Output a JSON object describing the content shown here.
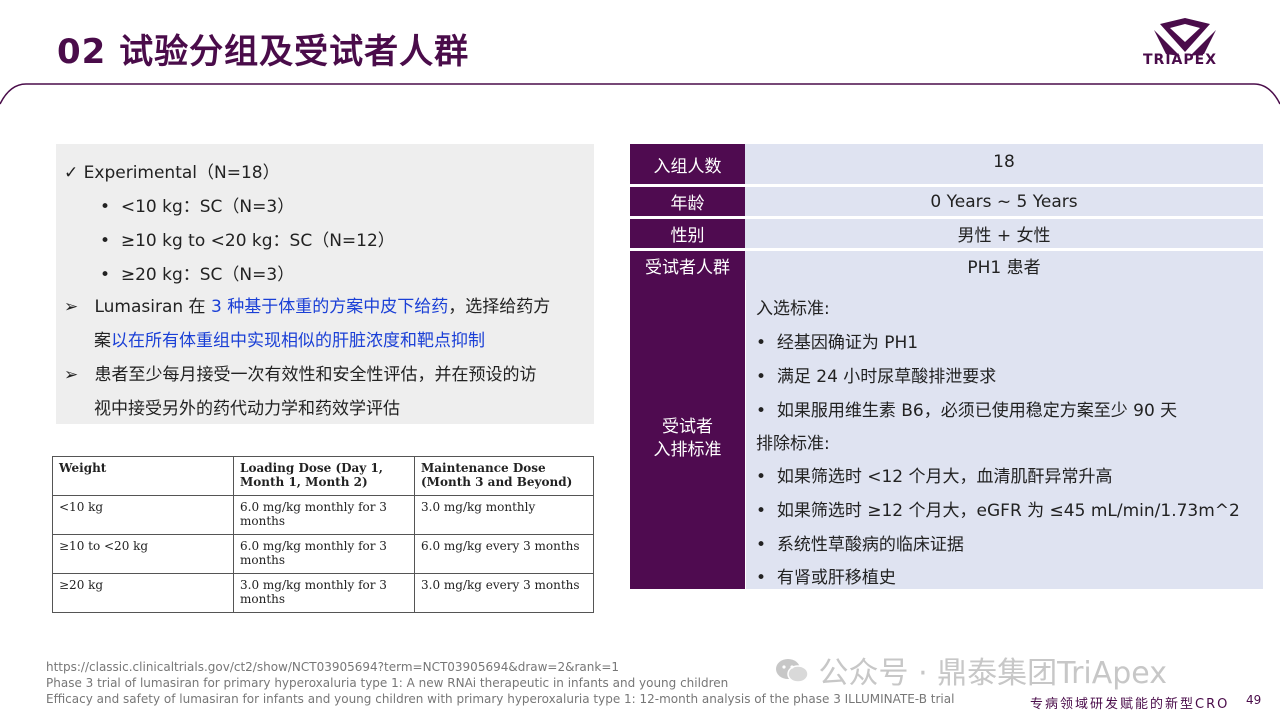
{
  "header": {
    "title": "02 试验分组及受试者人群",
    "logo_text": "TRIAPEX"
  },
  "experimental": {
    "heading": "✓ Experimental（N=18）",
    "bullets": [
      "<10 kg：SC（N=3）",
      "≥10 kg to <20 kg：SC（N=12）",
      "≥20 kg：SC（N=3）"
    ],
    "arrow1_a": "Lumasiran 在 ",
    "arrow1_b": "3 种基于体重的方案中皮下给药",
    "arrow1_c": "，选择给药方",
    "arrow1_d": "案",
    "arrow1_e": "以在所有体重组中实现相似的肝脏浓度和靶点抑制",
    "arrow2_line1": "患者至少每月接受一次有效性和安全性评估，并在预设的访",
    "arrow2_line2": "视中接受另外的药代动力学和药效学评估",
    "arrow_symbol": "➢",
    "bullet_symbol": "•"
  },
  "dose_table": {
    "headers": [
      "Weight",
      "Loading Dose (Day 1, Month 1, Month 2)",
      "Maintenance Dose (Month 3 and Beyond)"
    ],
    "rows": [
      [
        "<10 kg",
        "6.0 mg/kg monthly for 3 months",
        "3.0 mg/kg monthly"
      ],
      [
        "≥10 to <20 kg",
        "6.0 mg/kg monthly for 3 months",
        "6.0 mg/kg every 3 months"
      ],
      [
        "≥20 kg",
        "3.0 mg/kg monthly for 3 months",
        "3.0 mg/kg every 3 months"
      ]
    ]
  },
  "population": {
    "rows": [
      {
        "label": "入组人数",
        "value": "18"
      },
      {
        "label": "年龄",
        "value": "0 Years ~ 5 Years"
      },
      {
        "label": "性别",
        "value": "男性 + 女性"
      },
      {
        "label": "受试者人群",
        "value": "PH1 患者"
      }
    ],
    "criteria_label_1": "受试者",
    "criteria_label_2": "入排标准",
    "inclusion_title": "入选标准:",
    "inclusion": [
      "经基因确证为 PH1",
      "满足 24 小时尿草酸排泄要求",
      "如果服用维生素 B6，必须已使用稳定方案至少 90 天"
    ],
    "exclusion_title": "排除标准:",
    "exclusion": [
      "如果筛选时 <12 个月大，血清肌酐异常升高",
      "如果筛选时 ≥12 个月大，eGFR 为 ≤45 mL/min/1.73m^2",
      "系统性草酸病的临床证据",
      "有肾或肝移植史"
    ]
  },
  "references": [
    "https://classic.clinicaltrials.gov/ct2/show/NCT03905694?term=NCT03905694&draw=2&rank=1",
    "Phase 3 trial of lumasiran for primary hyperoxaluria type 1: A new RNAi therapeutic in infants and young children",
    "Efficacy and safety of lumasiran for infants and young children with primary hyperoxaluria type 1: 12-month analysis of the phase 3 ILLUMINATE-B trial"
  ],
  "watermark": "公众号 · 鼎泰集团TriApex",
  "footer": {
    "slogan": "专病领域研发赋能的新型CRO",
    "page": "49"
  },
  "colors": {
    "brand": "#4f0b50",
    "cell_bg": "#dfe3f1",
    "highlight": "#1a3fd6"
  }
}
